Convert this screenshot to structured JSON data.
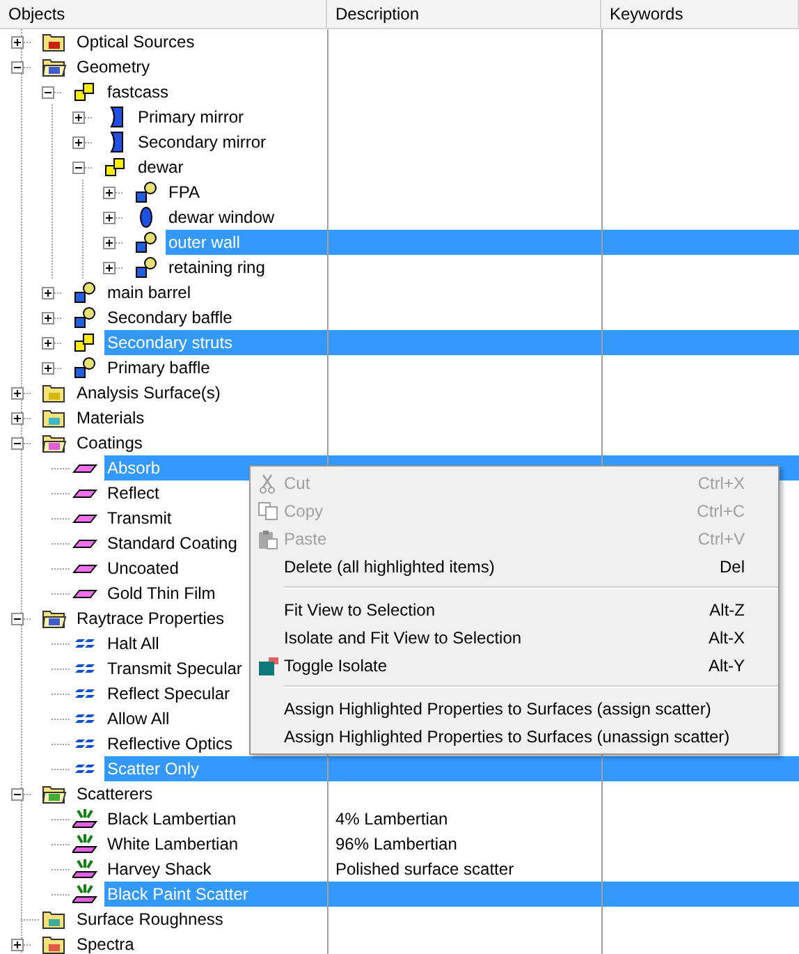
{
  "columns": [
    "Objects",
    "Description",
    "Keywords"
  ],
  "tree": [
    {
      "label": "Optical Sources",
      "kind": "folder-source",
      "expandable": true,
      "expanded": false,
      "selected": false
    },
    {
      "label": "Geometry",
      "kind": "folder-geometry",
      "expandable": true,
      "expanded": true,
      "selected": false,
      "children": [
        {
          "label": "fastcass",
          "kind": "assembly",
          "expandable": true,
          "expanded": true,
          "selected": false,
          "children": [
            {
              "label": "Primary mirror",
              "kind": "mirror",
              "expandable": true,
              "expanded": false,
              "selected": false
            },
            {
              "label": "Secondary mirror",
              "kind": "mirror",
              "expandable": true,
              "expanded": false,
              "selected": false
            },
            {
              "label": "dewar",
              "kind": "assembly",
              "expandable": true,
              "expanded": true,
              "selected": false,
              "children": [
                {
                  "label": "FPA",
                  "kind": "part",
                  "expandable": true,
                  "expanded": false,
                  "selected": false
                },
                {
                  "label": "dewar window",
                  "kind": "lens",
                  "expandable": true,
                  "expanded": false,
                  "selected": false
                },
                {
                  "label": "outer wall",
                  "kind": "part",
                  "expandable": true,
                  "expanded": false,
                  "selected": true
                },
                {
                  "label": "retaining ring",
                  "kind": "part",
                  "expandable": true,
                  "expanded": false,
                  "selected": false
                }
              ]
            }
          ]
        },
        {
          "label": "main barrel",
          "kind": "part",
          "expandable": true,
          "expanded": false,
          "selected": false
        },
        {
          "label": "Secondary baffle",
          "kind": "part",
          "expandable": true,
          "expanded": false,
          "selected": false
        },
        {
          "label": "Secondary struts",
          "kind": "assembly",
          "expandable": true,
          "expanded": false,
          "selected": true
        },
        {
          "label": "Primary baffle",
          "kind": "part",
          "expandable": true,
          "expanded": false,
          "selected": false
        }
      ]
    },
    {
      "label": "Analysis Surface(s)",
      "kind": "folder-analysis",
      "expandable": true,
      "expanded": false,
      "selected": false
    },
    {
      "label": "Materials",
      "kind": "folder-materials",
      "expandable": true,
      "expanded": false,
      "selected": false
    },
    {
      "label": "Coatings",
      "kind": "folder-coatings",
      "expandable": true,
      "expanded": true,
      "selected": false,
      "children": [
        {
          "label": "Absorb",
          "kind": "coating",
          "expandable": false,
          "selected": true
        },
        {
          "label": "Reflect",
          "kind": "coating",
          "expandable": false,
          "selected": false
        },
        {
          "label": "Transmit",
          "kind": "coating",
          "expandable": false,
          "selected": false
        },
        {
          "label": "Standard Coating",
          "kind": "coating",
          "expandable": false,
          "selected": false
        },
        {
          "label": "Uncoated",
          "kind": "coating",
          "expandable": false,
          "selected": false
        },
        {
          "label": "Gold Thin Film",
          "kind": "coating",
          "expandable": false,
          "selected": false
        }
      ]
    },
    {
      "label": "Raytrace Properties",
      "kind": "folder-raytrace",
      "expandable": true,
      "expanded": true,
      "selected": false,
      "children": [
        {
          "label": "Halt All",
          "kind": "raytrace",
          "expandable": false,
          "selected": false
        },
        {
          "label": "Transmit Specular",
          "kind": "raytrace",
          "expandable": false,
          "selected": false
        },
        {
          "label": "Reflect Specular",
          "kind": "raytrace",
          "expandable": false,
          "selected": false
        },
        {
          "label": "Allow All",
          "kind": "raytrace",
          "expandable": false,
          "selected": false
        },
        {
          "label": "Reflective Optics",
          "kind": "raytrace",
          "expandable": false,
          "selected": false
        },
        {
          "label": "Scatter Only",
          "kind": "raytrace",
          "expandable": false,
          "selected": true
        }
      ]
    },
    {
      "label": "Scatterers",
      "kind": "folder-scatterers",
      "expandable": true,
      "expanded": true,
      "selected": false,
      "children": [
        {
          "label": "Black Lambertian",
          "description": "4% Lambertian",
          "kind": "scatter",
          "expandable": false,
          "selected": false
        },
        {
          "label": "White Lambertian",
          "description": "96% Lambertian",
          "kind": "scatter",
          "expandable": false,
          "selected": false
        },
        {
          "label": "Harvey Shack",
          "description": "Polished surface scatter",
          "kind": "scatter",
          "expandable": false,
          "selected": false
        },
        {
          "label": "Black Paint Scatter",
          "kind": "scatter",
          "expandable": false,
          "selected": true
        }
      ]
    },
    {
      "label": "Surface Roughness",
      "kind": "folder-roughness",
      "expandable": false,
      "selected": false
    },
    {
      "label": "Spectra",
      "kind": "folder-spectra",
      "expandable": true,
      "expanded": false,
      "selected": false
    }
  ],
  "context_menu": [
    {
      "kind": "cut",
      "label": "Cut",
      "shortcut": "Ctrl+X",
      "disabled": true
    },
    {
      "kind": "copy",
      "label": "Copy",
      "shortcut": "Ctrl+C",
      "disabled": true
    },
    {
      "kind": "paste",
      "label": "Paste",
      "shortcut": "Ctrl+V",
      "disabled": true
    },
    {
      "kind": "item",
      "label": "Delete (all highlighted items)",
      "shortcut": "Del",
      "disabled": false
    },
    {
      "kind": "separator"
    },
    {
      "kind": "item",
      "label": "Fit View to Selection",
      "shortcut": "Alt-Z",
      "disabled": false
    },
    {
      "kind": "item",
      "label": "Isolate and Fit View to Selection",
      "shortcut": "Alt-X",
      "disabled": false
    },
    {
      "kind": "isolate",
      "label": "Toggle Isolate",
      "shortcut": "Alt-Y",
      "disabled": false
    },
    {
      "kind": "separator"
    },
    {
      "kind": "item",
      "label": "Assign Highlighted Properties to Surfaces (assign scatter)",
      "disabled": false
    },
    {
      "kind": "item",
      "label": "Assign Highlighted Properties to Surfaces (unassign scatter)",
      "disabled": false
    }
  ]
}
